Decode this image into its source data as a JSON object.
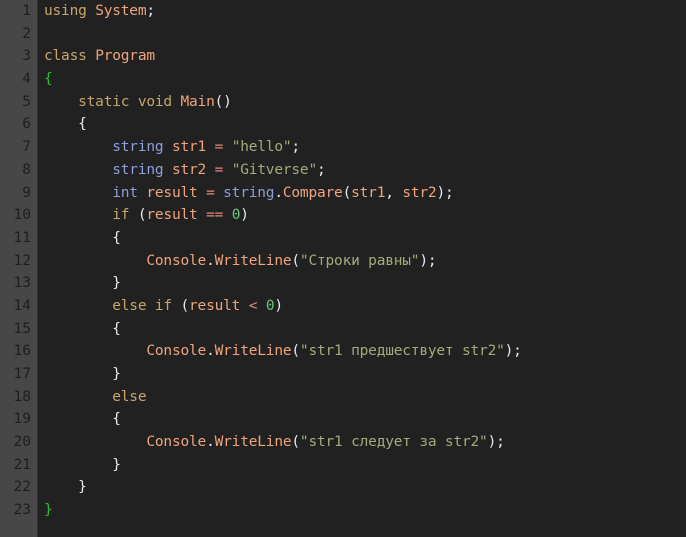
{
  "editor": {
    "line_numbers": [
      "1",
      "2",
      "3",
      "4",
      "5",
      "6",
      "7",
      "8",
      "9",
      "10",
      "11",
      "12",
      "13",
      "14",
      "15",
      "16",
      "17",
      "18",
      "19",
      "20",
      "21",
      "22",
      "23"
    ],
    "lines": [
      [
        {
          "t": "kw",
          "v": "using"
        },
        {
          "t": "pu",
          "v": " "
        },
        {
          "t": "id",
          "v": "System"
        },
        {
          "t": "pu",
          "v": ";"
        }
      ],
      [],
      [
        {
          "t": "kw",
          "v": "class"
        },
        {
          "t": "pu",
          "v": " "
        },
        {
          "t": "id",
          "v": "Program"
        }
      ],
      [
        {
          "t": "gb",
          "v": "{"
        }
      ],
      [
        {
          "t": "pu",
          "v": "    "
        },
        {
          "t": "kw",
          "v": "static"
        },
        {
          "t": "pu",
          "v": " "
        },
        {
          "t": "kw",
          "v": "void"
        },
        {
          "t": "pu",
          "v": " "
        },
        {
          "t": "id",
          "v": "Main"
        },
        {
          "t": "pu",
          "v": "()"
        }
      ],
      [
        {
          "t": "pu",
          "v": "    {"
        }
      ],
      [
        {
          "t": "pu",
          "v": "        "
        },
        {
          "t": "ty",
          "v": "string"
        },
        {
          "t": "pu",
          "v": " "
        },
        {
          "t": "id",
          "v": "str1"
        },
        {
          "t": "pu",
          "v": " "
        },
        {
          "t": "op",
          "v": "="
        },
        {
          "t": "pu",
          "v": " "
        },
        {
          "t": "st",
          "v": "\"hello\""
        },
        {
          "t": "pu",
          "v": ";"
        }
      ],
      [
        {
          "t": "pu",
          "v": "        "
        },
        {
          "t": "ty",
          "v": "string"
        },
        {
          "t": "pu",
          "v": " "
        },
        {
          "t": "id",
          "v": "str2"
        },
        {
          "t": "pu",
          "v": " "
        },
        {
          "t": "op",
          "v": "="
        },
        {
          "t": "pu",
          "v": " "
        },
        {
          "t": "st",
          "v": "\"Gitverse\""
        },
        {
          "t": "pu",
          "v": ";"
        }
      ],
      [
        {
          "t": "pu",
          "v": "        "
        },
        {
          "t": "ty",
          "v": "int"
        },
        {
          "t": "pu",
          "v": " "
        },
        {
          "t": "id",
          "v": "result"
        },
        {
          "t": "pu",
          "v": " "
        },
        {
          "t": "op",
          "v": "="
        },
        {
          "t": "pu",
          "v": " "
        },
        {
          "t": "ty",
          "v": "string"
        },
        {
          "t": "pu",
          "v": "."
        },
        {
          "t": "id",
          "v": "Compare"
        },
        {
          "t": "pu",
          "v": "("
        },
        {
          "t": "id",
          "v": "str1"
        },
        {
          "t": "pu",
          "v": ", "
        },
        {
          "t": "id",
          "v": "str2"
        },
        {
          "t": "pu",
          "v": ");"
        }
      ],
      [
        {
          "t": "pu",
          "v": "        "
        },
        {
          "t": "kw",
          "v": "if"
        },
        {
          "t": "pu",
          "v": " ("
        },
        {
          "t": "id",
          "v": "result"
        },
        {
          "t": "pu",
          "v": " "
        },
        {
          "t": "op",
          "v": "=="
        },
        {
          "t": "pu",
          "v": " "
        },
        {
          "t": "nu",
          "v": "0"
        },
        {
          "t": "pu",
          "v": ")"
        }
      ],
      [
        {
          "t": "pu",
          "v": "        {"
        }
      ],
      [
        {
          "t": "pu",
          "v": "            "
        },
        {
          "t": "id",
          "v": "Console"
        },
        {
          "t": "pu",
          "v": "."
        },
        {
          "t": "id",
          "v": "WriteLine"
        },
        {
          "t": "pu",
          "v": "("
        },
        {
          "t": "st",
          "v": "\"Строки равны\""
        },
        {
          "t": "pu",
          "v": ");"
        }
      ],
      [
        {
          "t": "pu",
          "v": "        }"
        }
      ],
      [
        {
          "t": "pu",
          "v": "        "
        },
        {
          "t": "kw",
          "v": "else"
        },
        {
          "t": "pu",
          "v": " "
        },
        {
          "t": "kw",
          "v": "if"
        },
        {
          "t": "pu",
          "v": " ("
        },
        {
          "t": "id",
          "v": "result"
        },
        {
          "t": "pu",
          "v": " "
        },
        {
          "t": "op",
          "v": "<"
        },
        {
          "t": "pu",
          "v": " "
        },
        {
          "t": "nu",
          "v": "0"
        },
        {
          "t": "pu",
          "v": ")"
        }
      ],
      [
        {
          "t": "pu",
          "v": "        {"
        }
      ],
      [
        {
          "t": "pu",
          "v": "            "
        },
        {
          "t": "id",
          "v": "Console"
        },
        {
          "t": "pu",
          "v": "."
        },
        {
          "t": "id",
          "v": "WriteLine"
        },
        {
          "t": "pu",
          "v": "("
        },
        {
          "t": "st",
          "v": "\"str1 предшествует str2\""
        },
        {
          "t": "pu",
          "v": ");"
        }
      ],
      [
        {
          "t": "pu",
          "v": "        }"
        }
      ],
      [
        {
          "t": "pu",
          "v": "        "
        },
        {
          "t": "kw",
          "v": "else"
        }
      ],
      [
        {
          "t": "pu",
          "v": "        {"
        }
      ],
      [
        {
          "t": "pu",
          "v": "            "
        },
        {
          "t": "id",
          "v": "Console"
        },
        {
          "t": "pu",
          "v": "."
        },
        {
          "t": "id",
          "v": "WriteLine"
        },
        {
          "t": "pu",
          "v": "("
        },
        {
          "t": "st",
          "v": "\"str1 следует за str2\""
        },
        {
          "t": "pu",
          "v": ");"
        }
      ],
      [
        {
          "t": "pu",
          "v": "        }"
        }
      ],
      [
        {
          "t": "pu",
          "v": "    }"
        }
      ],
      [
        {
          "t": "gb",
          "v": "}"
        }
      ]
    ]
  },
  "colors": {
    "background": "#222222",
    "gutter": "#474747",
    "keyword": "#c9a56a",
    "identifier": "#f0a47a",
    "type": "#8e9edc",
    "string": "#a0ad78",
    "number": "#6cc47e",
    "punctuation": "#e4eaf2",
    "outer_brace": "#30c030"
  }
}
